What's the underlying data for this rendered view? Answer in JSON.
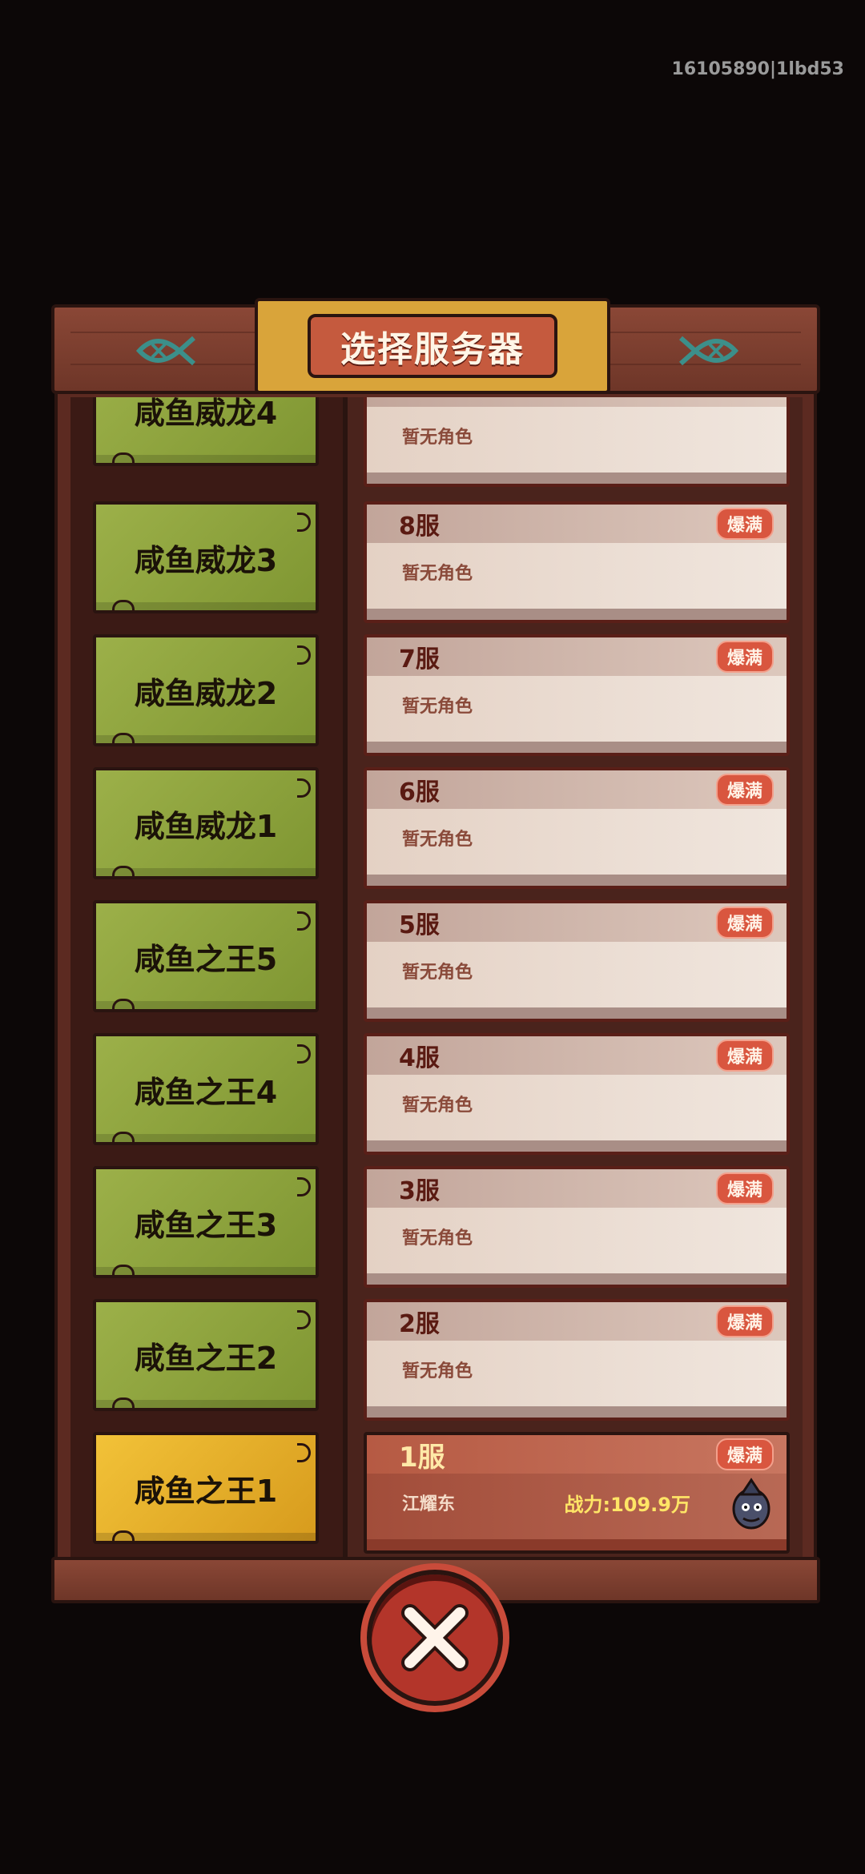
{
  "device_id": "16105890|1lbd53",
  "title": "选择服务器",
  "regions": [
    {
      "label": "咸鱼威龙4",
      "selected": false
    },
    {
      "label": "咸鱼威龙3",
      "selected": false
    },
    {
      "label": "咸鱼威龙2",
      "selected": false
    },
    {
      "label": "咸鱼威龙1",
      "selected": false
    },
    {
      "label": "咸鱼之王5",
      "selected": false
    },
    {
      "label": "咸鱼之王4",
      "selected": false
    },
    {
      "label": "咸鱼之王3",
      "selected": false
    },
    {
      "label": "咸鱼之王2",
      "selected": false
    },
    {
      "label": "咸鱼之王1",
      "selected": true
    }
  ],
  "servers": [
    {
      "name": "",
      "badge": "",
      "status": "暂无角色"
    },
    {
      "name": "8服",
      "badge": "爆满",
      "status": "暂无角色"
    },
    {
      "name": "7服",
      "badge": "爆满",
      "status": "暂无角色"
    },
    {
      "name": "6服",
      "badge": "爆满",
      "status": "暂无角色"
    },
    {
      "name": "5服",
      "badge": "爆满",
      "status": "暂无角色"
    },
    {
      "name": "4服",
      "badge": "爆满",
      "status": "暂无角色"
    },
    {
      "name": "3服",
      "badge": "爆满",
      "status": "暂无角色"
    },
    {
      "name": "2服",
      "badge": "爆满",
      "status": "暂无角色"
    }
  ],
  "selected_server": {
    "name": "1服",
    "badge": "爆满",
    "character": "江耀东",
    "power": "战力:109.9万"
  },
  "colors": {
    "region_green": "#8ea33d",
    "region_selected": "#e6ad2a",
    "badge_red": "#d9563f",
    "frame_wood": "#6e3628"
  },
  "icons": {
    "header_left": "fish-icon",
    "header_right": "fish-icon",
    "close": "close-icon",
    "avatar": "character-avatar-icon"
  }
}
